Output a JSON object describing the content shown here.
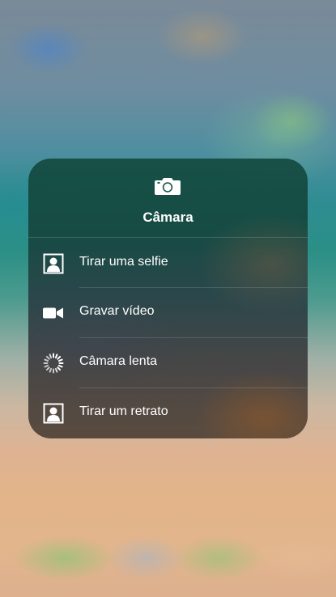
{
  "menu": {
    "title": "Câmara",
    "header_icon": "camera-icon",
    "items": [
      {
        "label": "Tirar uma selfie",
        "icon": "portrait-frame-icon"
      },
      {
        "label": "Gravar vídeo",
        "icon": "video-camera-icon"
      },
      {
        "label": "Câmara lenta",
        "icon": "slow-motion-icon"
      },
      {
        "label": "Tirar um retrato",
        "icon": "portrait-frame-icon"
      }
    ]
  },
  "colors": {
    "text": "#ffffff",
    "menu_top": "#144b41",
    "menu_bottom": "#4e4237"
  }
}
